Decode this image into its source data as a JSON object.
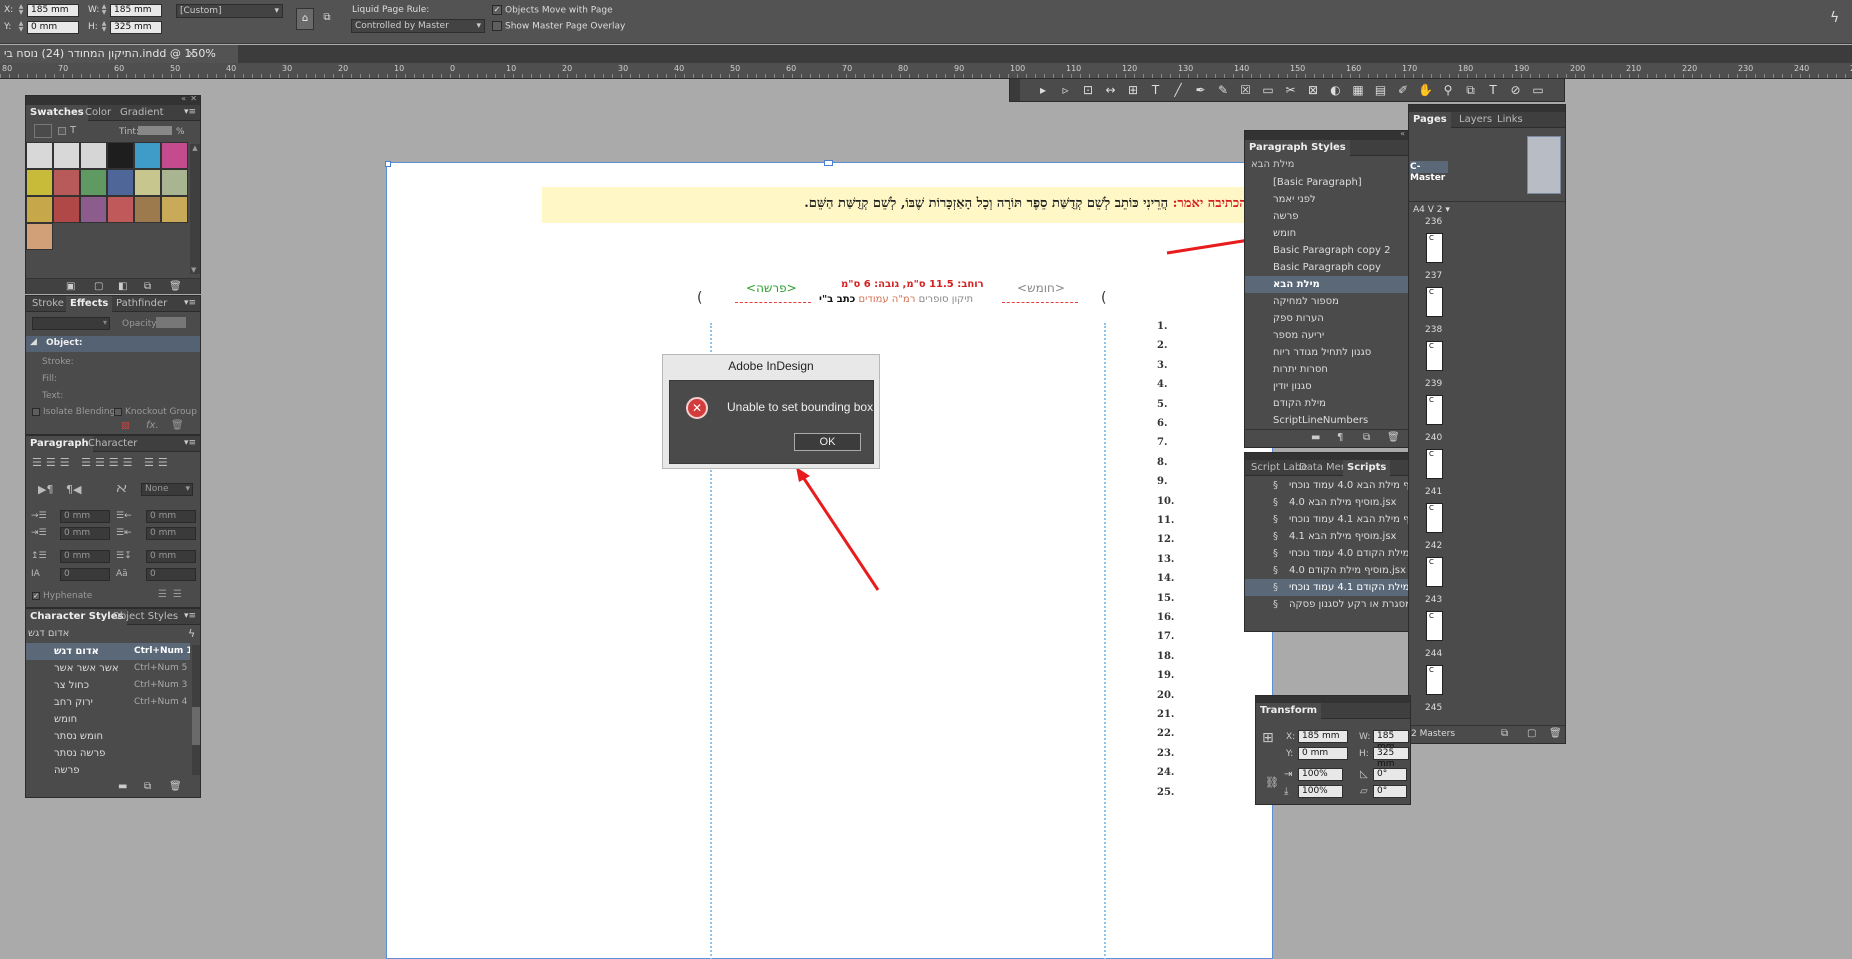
{
  "control_bar": {
    "x_label": "X:",
    "x_value": "185 mm",
    "y_label": "Y:",
    "y_value": "0 mm",
    "w_label": "W:",
    "w_value": "185 mm",
    "h_label": "H:",
    "h_value": "325 mm",
    "preset_value": "[Custom]",
    "liquid_label": "Liquid Page Rule:",
    "liquid_value": "Controlled by Master",
    "objects_move": "Objects Move with Page",
    "show_overlay": "Show Master Page Overlay"
  },
  "document_tab": {
    "title": "התיקון המחודר (24) נוסח בי.indd @ 150%",
    "close": "×"
  },
  "ruler_numbers": [
    "80",
    "70",
    "60",
    "50",
    "40",
    "30",
    "20",
    "10",
    "0",
    "10",
    "20",
    "30",
    "40",
    "50",
    "60",
    "70",
    "80",
    "90",
    "100",
    "110",
    "120",
    "130",
    "140",
    "150",
    "160",
    "170",
    "180",
    "190",
    "200",
    "210",
    "220",
    "230",
    "240",
    "250",
    "260"
  ],
  "swatches_panel": {
    "tabs": [
      "Swatches",
      "Color",
      "Gradient"
    ],
    "tint_label": "Tint:",
    "tint_unit": "%",
    "colors": [
      "#d8d8d8",
      "#d8d8d8",
      "#d6d6d6",
      "#1e1e1e",
      "#3f9cc9",
      "#c54b8f",
      "#c8bb3a",
      "#b85a5a",
      "#5e9a62",
      "#4f6698",
      "#c6c68e",
      "#a8b590",
      "#c6a84a",
      "#b04848",
      "#8c5c8c",
      "#c05a5a",
      "#9c7a4e",
      "#c8aa58",
      "#d1a078"
    ]
  },
  "effects_panel": {
    "tabs": [
      "Stroke",
      "Effects",
      "Pathfinder"
    ],
    "opacity_label": "Opacity:",
    "object_label": "Object:",
    "stroke_label": "Stroke:",
    "fill_label": "Fill:",
    "text_label": "Text:",
    "isolate": "Isolate Blending",
    "knockout": "Knockout Group"
  },
  "paragraph_panel": {
    "tabs": [
      "Paragraph",
      "Character"
    ],
    "none_value": "None",
    "fields": [
      "0 mm",
      "0 mm",
      "0 mm",
      "0 mm",
      "0 mm",
      "0 mm",
      "0",
      "0"
    ],
    "hyphenate": "Hyphenate"
  },
  "character_styles_panel": {
    "tabs": [
      "Character Styles",
      "Object Styles"
    ],
    "current": "אדום דגש",
    "items": [
      {
        "name": "אדום דגש",
        "shortcut": "Ctrl+Num 1"
      },
      {
        "name": "אשר אשר אשר",
        "shortcut": "Ctrl+Num 5"
      },
      {
        "name": "כחול צר",
        "shortcut": "Ctrl+Num 3"
      },
      {
        "name": "ירוק רחב",
        "shortcut": "Ctrl+Num 4"
      },
      {
        "name": "חומש",
        "shortcut": ""
      },
      {
        "name": "חומש נסתר",
        "shortcut": ""
      },
      {
        "name": "פרשה נסתר",
        "shortcut": ""
      },
      {
        "name": "פרשה",
        "shortcut": ""
      }
    ]
  },
  "toolbar": {
    "tools": [
      "▸",
      "▹",
      "⊡",
      "↔",
      "⊞",
      "T",
      "╱",
      "✒",
      "✎",
      "☒",
      "▭",
      "✂",
      "⊠",
      "◐",
      "▦",
      "▤",
      "✐",
      "✋",
      "⚲",
      "⧉",
      "T",
      "⊘",
      "▭"
    ]
  },
  "pages_panel": {
    "tabs": [
      "Pages",
      "Layers",
      "Links"
    ],
    "master": "C-Master",
    "page_size": "A4 V 2",
    "pages": [
      "236",
      "237",
      "238",
      "239",
      "240",
      "241",
      "242",
      "243",
      "244",
      "245"
    ],
    "thumb_letter": "C",
    "footer": "2 Masters"
  },
  "paragraph_styles_panel": {
    "title": "Paragraph Styles",
    "current": "מילת הבא",
    "items": [
      "[Basic Paragraph]",
      "לפני יאמר",
      "פרשה",
      "חומש",
      "Basic Paragraph copy 2",
      "Basic Paragraph copy",
      "מילת הבא",
      "מספור למחיקה",
      "הערות ספק",
      "יריעה מספר",
      "סגנון לתחיל מגודר ריוח",
      "חסרות יתרות",
      "סגנון יודין",
      "מילת הקודם",
      "ScriptLineNumbers"
    ]
  },
  "scripts_panel": {
    "tabs": [
      "Script Labe",
      "Data Merg",
      "Scripts"
    ],
    "items": [
      "מוסיף מילת הבא 4.0 עמוד נוכחי",
      "מוסיף מילת הבא 4.0.jsx",
      "מוסיף מילת הבא 4.1 עמוד נוכחי",
      "מוסיף מילת הבא 4.1.jsx",
      "מוסיף מילת הקודם 4.0 עמוד נוכחי",
      "מוסיף מילת הקודם 4.0.jsx",
      "מוסיף מילת הקודם 4.1 עמוד נוכחי",
      "מסגרת או רקע לסגנון פסקה.jsx"
    ]
  },
  "transform_panel": {
    "title": "Transform",
    "x": "185 mm",
    "y": "0 mm",
    "w": "185 mm",
    "h": "325 mm",
    "scale_x": "100%",
    "scale_y": "100%",
    "rotate": "0°",
    "shear": "0°"
  },
  "document": {
    "header_label": "לפני הכתיבה יאמר:",
    "header_text": "הֲרֵינִי כּוֹתֵב לְשֵׁם קְדֻשַּׁת סֵפֶר תּוֹרָה וְכָל הָאַזְכָּרוֹת שֶׁבּוֹ, לְשֵׁם קְדֻשַּׁת הַשֵּׁם.",
    "parasha": "<פרשה>",
    "chumash": "<חומש>",
    "dims": "רוחב: 11.5 ס\"מ, גובה: 6 ס\"מ",
    "sub_gray": "תיקון סופרים",
    "sub_red": "רמ\"ה עמודים",
    "sub_black": "כתב ב\"י",
    "bracket_left": "(",
    "bracket_right": "(",
    "line_numbers": [
      "1.",
      "2.",
      "3.",
      "4.",
      "5.",
      "6.",
      "7.",
      "8.",
      "9.",
      "10.",
      "11.",
      "12.",
      "13.",
      "14.",
      "15.",
      "16.",
      "17.",
      "18.",
      "19.",
      "20.",
      "21.",
      "22.",
      "23.",
      "24.",
      "25."
    ]
  },
  "dialog": {
    "title": "Adobe InDesign",
    "message": "Unable to set bounding box.",
    "ok_label": "OK"
  }
}
